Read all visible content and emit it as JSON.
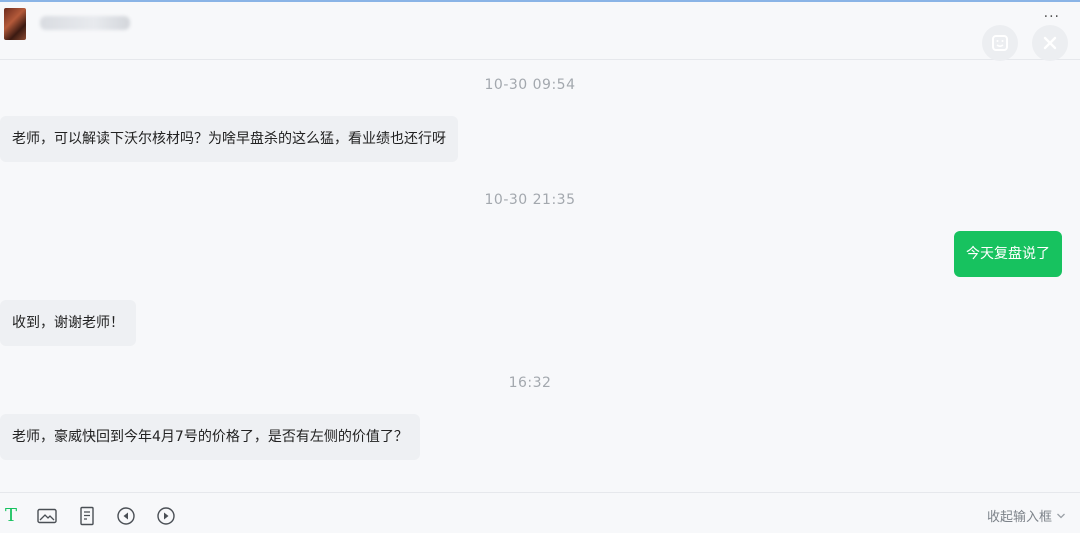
{
  "header": {
    "contact_name": "",
    "more_label": "···"
  },
  "messages": [
    {
      "type": "time",
      "text": "10-30 09:54"
    },
    {
      "type": "in",
      "text": "老师，可以解读下沃尔核材吗？为啥早盘杀的这么猛，看业绩也还行呀"
    },
    {
      "type": "time",
      "text": "10-30 21:35"
    },
    {
      "type": "out",
      "text": "今天复盘说了"
    },
    {
      "type": "in",
      "text": "收到，谢谢老师！"
    },
    {
      "type": "time",
      "text": "16:32"
    },
    {
      "type": "in",
      "text": "老师，豪威快回到今年4月7号的价格了，是否有左侧的价值了？"
    }
  ],
  "toolbar": {
    "text_tool_label": "T",
    "collapse_label": "收起输入框"
  },
  "colors": {
    "accent_green": "#17c25f",
    "incoming_bubble": "#eef0f3",
    "background": "#f7f8fa"
  }
}
